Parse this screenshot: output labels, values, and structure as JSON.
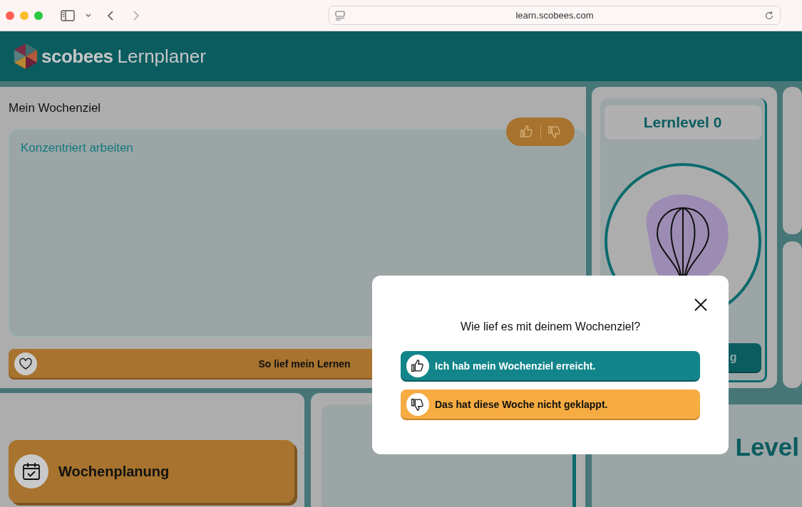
{
  "browser": {
    "url": "learn.scobees.com"
  },
  "header": {
    "brand": "scobees",
    "product": "Lernplaner"
  },
  "goal": {
    "title": "Mein Wochenziel",
    "text": "Konzentriert arbeiten",
    "rating_toggle": {
      "disabled": true
    },
    "feedback_button": "So lief mein Lernen"
  },
  "level_card": {
    "title": "Lernlevel 0",
    "button_fragment": "g"
  },
  "tiles": [
    {
      "kind": "action",
      "label": "Wochenplanung"
    },
    {
      "kind": "panel"
    },
    {
      "kind": "heading",
      "label": "Level"
    }
  ],
  "dialog": {
    "question": "Wie lief es mit deinem Wochenziel?",
    "options": [
      {
        "kind": "positive",
        "label": "Ich hab mein Wochenziel erreicht."
      },
      {
        "kind": "negative",
        "label": "Das hat diese Woche nicht geklappt."
      }
    ]
  }
}
